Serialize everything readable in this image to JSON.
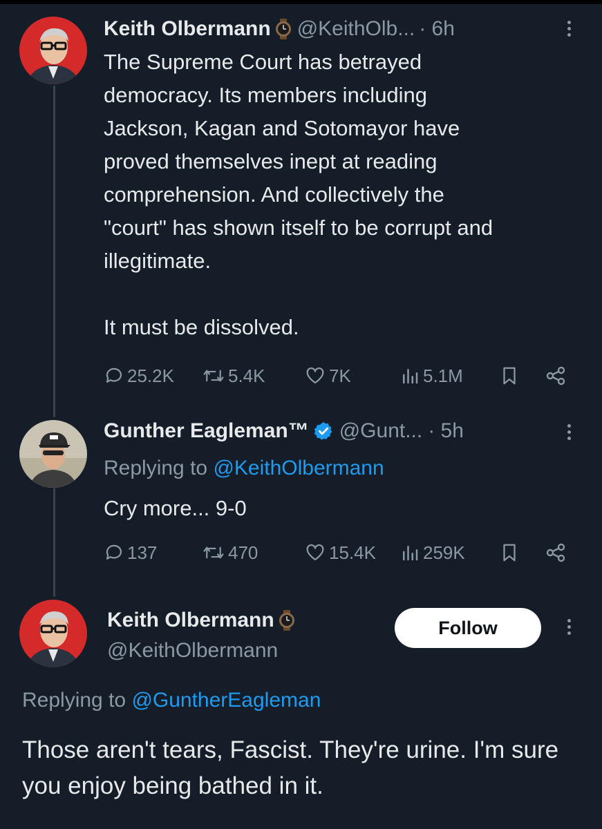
{
  "tweets": [
    {
      "name": "Keith Olbermann",
      "handle": "@KeithOlb...",
      "time": "· 6h",
      "text": "The Supreme Court has betrayed\ndemocracy. Its members including\nJackson, Kagan and Sotomayor have\nproved themselves inept at reading\ncomprehension. And collectively the\n\"court\" has shown itself to be corrupt and\nillegitimate.\n\nIt must be dissolved.",
      "replies": "25.2K",
      "retweets": "5.4K",
      "likes": "7K",
      "views": "5.1M"
    },
    {
      "name": "Gunther Eagleman™",
      "handle": "@Gunt...",
      "time": "· 5h",
      "replying_prefix": "Replying to ",
      "replying_to": "@KeithOlbermann",
      "text": "Cry more... 9-0",
      "replies": "137",
      "retweets": "470",
      "likes": "15.4K",
      "views": "259K"
    }
  ],
  "focused": {
    "name": "Keith Olbermann",
    "handle": "@KeithOlbermann",
    "follow_label": "Follow",
    "replying_prefix": "Replying to ",
    "replying_to": "@GuntherEagleman",
    "text": "Those aren't tears, Fascist. They're urine. I'm sure you enjoy being bathed in it."
  },
  "colors": {
    "background": "#151d28",
    "link": "#1d9bf0",
    "secondary_text": "#8b98a5",
    "verified": "#1d9bf0"
  },
  "icons": [
    "reply-icon",
    "retweet-icon",
    "like-icon",
    "views-icon",
    "bookmark-icon",
    "share-icon",
    "more-icon",
    "verified-badge-icon",
    "watch-emoji-icon"
  ]
}
